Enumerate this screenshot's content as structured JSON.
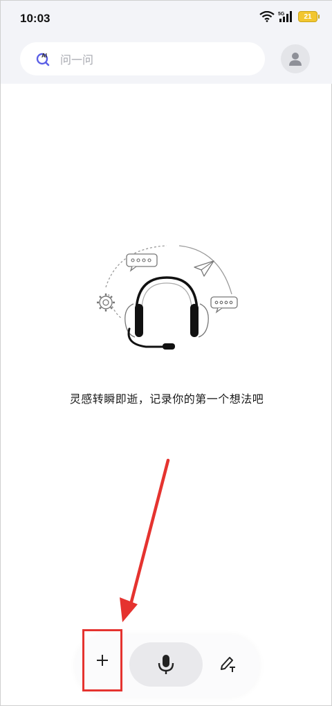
{
  "status_bar": {
    "time": "10:03",
    "network": "5G",
    "battery": "21",
    "battery_color": "#f2c630"
  },
  "header": {
    "search": {
      "icon": "ai-search-icon",
      "icon_label": "AI",
      "placeholder": "问一问"
    },
    "avatar_icon": "user-icon"
  },
  "empty_state": {
    "illustration_icon": "headphones-illustration",
    "message": "灵感转瞬即逝，记录你的第一个想法吧"
  },
  "bottom_bar": {
    "add_icon": "plus-icon",
    "voice_icon": "microphone-icon",
    "text_icon": "pen-text-icon"
  },
  "annotation": {
    "color": "#e5332f"
  }
}
